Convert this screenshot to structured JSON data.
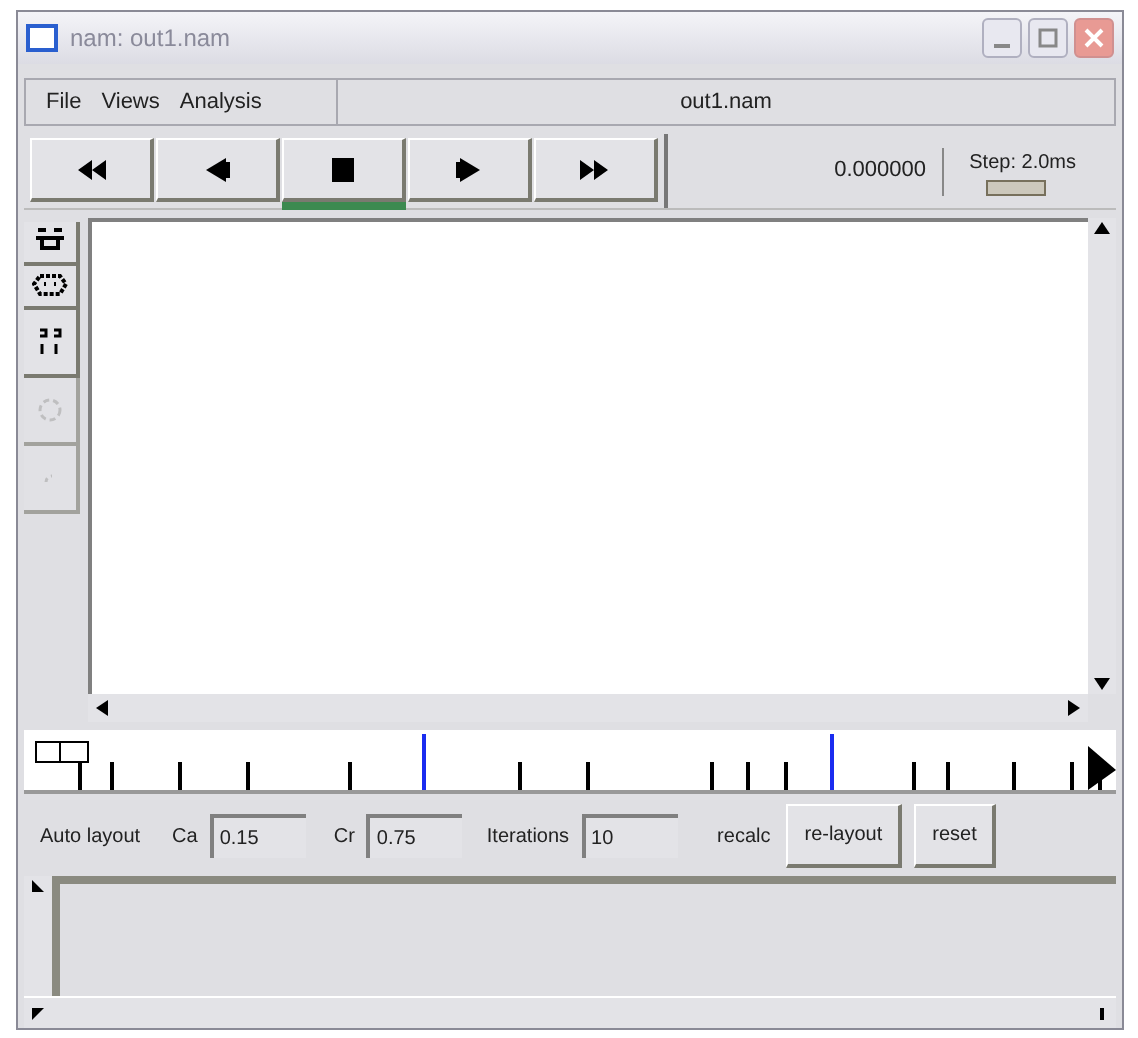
{
  "window": {
    "title": "nam: out1.nam"
  },
  "menu": [
    {
      "label": "File"
    },
    {
      "label": "Views"
    },
    {
      "label": "Analysis"
    }
  ],
  "file_label": "out1.nam",
  "playback": [
    {
      "kind": "rewind",
      "selected": false
    },
    {
      "kind": "back",
      "selected": false
    },
    {
      "kind": "stop",
      "selected": true
    },
    {
      "kind": "play",
      "selected": false
    },
    {
      "kind": "fastforward",
      "selected": false
    }
  ],
  "time": "0.000000",
  "step": {
    "label": "Step: 2.0ms"
  },
  "tools": [
    {
      "kind": "select",
      "disabled": false
    },
    {
      "kind": "edit",
      "disabled": false
    },
    {
      "kind": "zoom",
      "disabled": false
    },
    {
      "kind": "circle",
      "disabled": true
    },
    {
      "kind": "arc",
      "disabled": true
    }
  ],
  "layout": {
    "label": "Auto layout",
    "ca_label": "Ca",
    "ca": "0.15",
    "cr_label": "Cr",
    "cr": "0.75",
    "iterations_label": "Iterations",
    "iterations": "10",
    "recalc": "recalc",
    "relayout": "re-layout",
    "reset": "reset"
  }
}
